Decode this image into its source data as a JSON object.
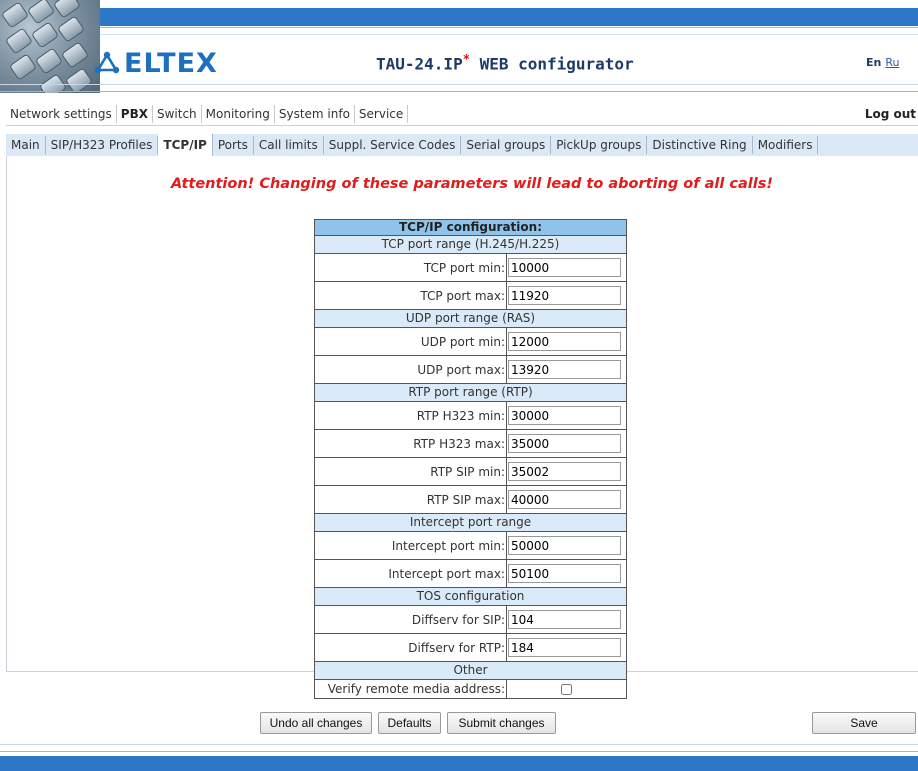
{
  "header": {
    "logo_text": "ELTEX",
    "app_title": "TAU-24.IP",
    "app_title_mark": "*",
    "app_title_suffix": " WEB configurator",
    "lang_en": "En",
    "lang_ru": "Ru"
  },
  "main_menu": {
    "items": [
      "Network settings",
      "PBX",
      "Switch",
      "Monitoring",
      "System info",
      "Service"
    ],
    "active": "PBX",
    "logout": "Log out"
  },
  "sub_menu": {
    "items": [
      "Main",
      "SIP/H323 Profiles",
      "TCP/IP",
      "Ports",
      "Call limits",
      "Suppl. Service Codes",
      "Serial groups",
      "PickUp groups",
      "Distinctive Ring",
      "Modifiers"
    ],
    "active": "TCP/IP"
  },
  "warning": "Attention! Changing of these parameters will lead to aborting of all calls!",
  "config": {
    "title": "TCP/IP configuration:",
    "sections": [
      {
        "name": "TCP port range (H.245/H.225)",
        "fields": [
          {
            "label": "TCP port min:",
            "value": "10000"
          },
          {
            "label": "TCP port max:",
            "value": "11920"
          }
        ]
      },
      {
        "name": "UDP port range (RAS)",
        "fields": [
          {
            "label": "UDP port min:",
            "value": "12000"
          },
          {
            "label": "UDP port max:",
            "value": "13920"
          }
        ]
      },
      {
        "name": "RTP port range (RTP)",
        "fields": [
          {
            "label": "RTP H323 min:",
            "value": "30000"
          },
          {
            "label": "RTP H323 max:",
            "value": "35000"
          },
          {
            "label": "RTP SIP min:",
            "value": "35002"
          },
          {
            "label": "RTP SIP max:",
            "value": "40000"
          }
        ]
      },
      {
        "name": "Intercept port range",
        "fields": [
          {
            "label": "Intercept port min:",
            "value": "50000"
          },
          {
            "label": "Intercept port max:",
            "value": "50100"
          }
        ]
      },
      {
        "name": "TOS configuration",
        "fields": [
          {
            "label": "Diffserv for SIP:",
            "value": "104"
          },
          {
            "label": "Diffserv for RTP:",
            "value": "184"
          }
        ]
      },
      {
        "name": "Other",
        "fields": [
          {
            "label": "Verify remote media address:",
            "value": "",
            "type": "checkbox",
            "checked": false
          }
        ]
      }
    ]
  },
  "buttons": {
    "undo": "Undo all changes",
    "defaults": "Defaults",
    "submit": "Submit changes",
    "save": "Save"
  },
  "colors": {
    "brand_blue": "#2c78c6",
    "warning_red": "#e31b1b",
    "table_header": "#8fc4ea",
    "section_bg": "#dbeaf8"
  }
}
